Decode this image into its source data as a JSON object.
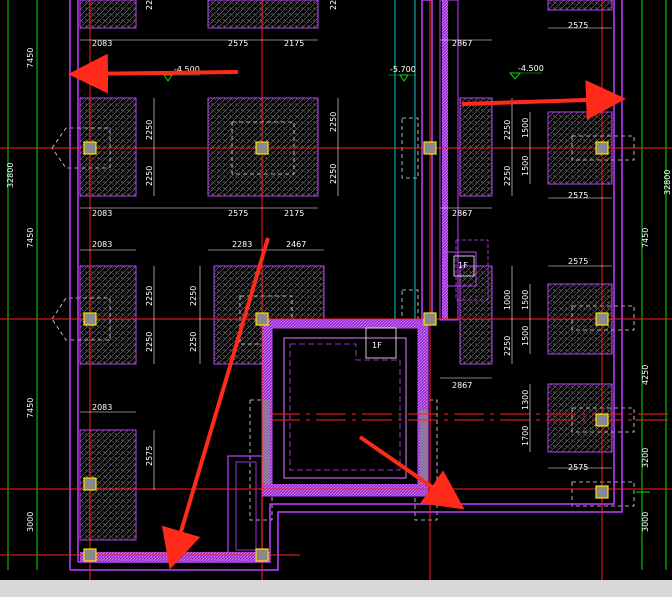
{
  "colors": {
    "background": "#000000",
    "wall_magenta": "#c040ff",
    "axis_red": "#ff2020",
    "grid_green": "#00e000",
    "column_yellow": "#ffe000",
    "hatch_gray": "#9a9a9a",
    "arrow_red": "#ff2a1a",
    "dim_text": "#ffffff",
    "cyan": "#00d0d0",
    "dashed_white": "#e0e0e0"
  },
  "left_dimensions": [
    "7450",
    "32800",
    "7450",
    "7450",
    "3000"
  ],
  "right_dimensions": [
    "32800",
    "7450",
    "4250",
    "3200",
    "3000"
  ],
  "level_marks": [
    "-4.500",
    "-5.700",
    "-4.500"
  ],
  "pile_dimensions": {
    "top_row": [
      "2083",
      "2575",
      "2175",
      "2867"
    ],
    "v_2250": "2250",
    "row2_bottom": [
      "2083",
      "2575",
      "2175",
      "2867",
      "2575"
    ],
    "row2_right_v": [
      "1500",
      "1500"
    ],
    "row3_top": [
      "2083",
      "2283",
      "2467",
      "2575"
    ],
    "row3_right_v": [
      "1500",
      "1500",
      "2250",
      "1000"
    ],
    "row3_bottom": [
      "2867"
    ],
    "row4": [
      "2083",
      "2575",
      "1300",
      "1700",
      "2575"
    ],
    "row4_left_v": "2575"
  },
  "elevator_labels": [
    "1F",
    "1F"
  ],
  "annotation": {
    "arrows": 4
  }
}
